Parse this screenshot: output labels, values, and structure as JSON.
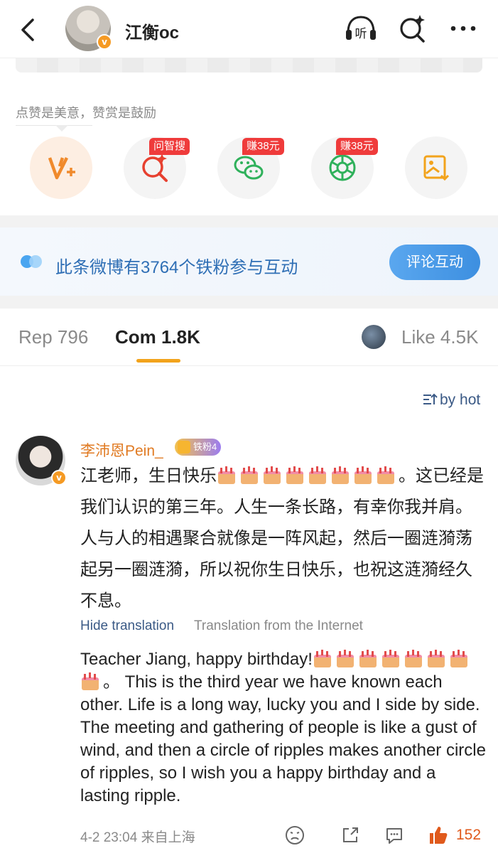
{
  "header": {
    "title": "江衡oc",
    "verified_badge": "v",
    "icons": [
      "back-icon",
      "listen-icon",
      "smart-search-icon",
      "more-icon"
    ],
    "listen_label": "听"
  },
  "praise": {
    "text": "点赞是美意，赞赏是鼓励",
    "actions": [
      {
        "icon": "v-plus-icon",
        "tag": ""
      },
      {
        "icon": "ask-search-icon",
        "tag": "问智搜"
      },
      {
        "icon": "wechat-icon",
        "tag": "赚38元"
      },
      {
        "icon": "moments-icon",
        "tag": "赚38元"
      },
      {
        "icon": "save-image-icon",
        "tag": ""
      }
    ]
  },
  "fans_bar": {
    "text": "此条微博有3764个铁粉参与互动",
    "button": "评论互动"
  },
  "tabs": {
    "rep": "Rep 796",
    "com": "Com 1.8K",
    "like": "Like 4.5K"
  },
  "sort": "by hot",
  "comment": {
    "author": "李沛恩Pein_",
    "fan_badge": "铁粉4",
    "text_before": "江老师，生日快乐",
    "cakes_zh": 8,
    "text_after": "。这已经是我们认识的第三年。人生一条长路，有幸你我并肩。人与人的相遇聚合就像是一阵风起，然后一圈涟漪荡起另一圈涟漪，所以祝你生日快乐，也祝这涟漪经久不息。",
    "hide_translation": "Hide translation",
    "translation_source": "Translation from the Internet",
    "translation_before": "Teacher Jiang, happy birthday!",
    "cakes_en": 8,
    "translation_after": "。 This is the third year we have known each other. Life is a long way, lucky you and I side by side. The meeting and gathering of people is like a gust of wind, and then a circle of ripples makes another circle of ripples, so I wish you a happy birthday and a lasting ripple.",
    "time_location": "4-2 23:04  来自上海",
    "likes": "152",
    "action_icons": [
      "dislike-icon",
      "share-icon",
      "reply-icon",
      "like-icon"
    ]
  },
  "colors": {
    "accent_orange": "#f2a31c",
    "link_blue": "#3b5a86",
    "like_orange": "#e05a1c",
    "tag_red": "#ef3b3b"
  }
}
